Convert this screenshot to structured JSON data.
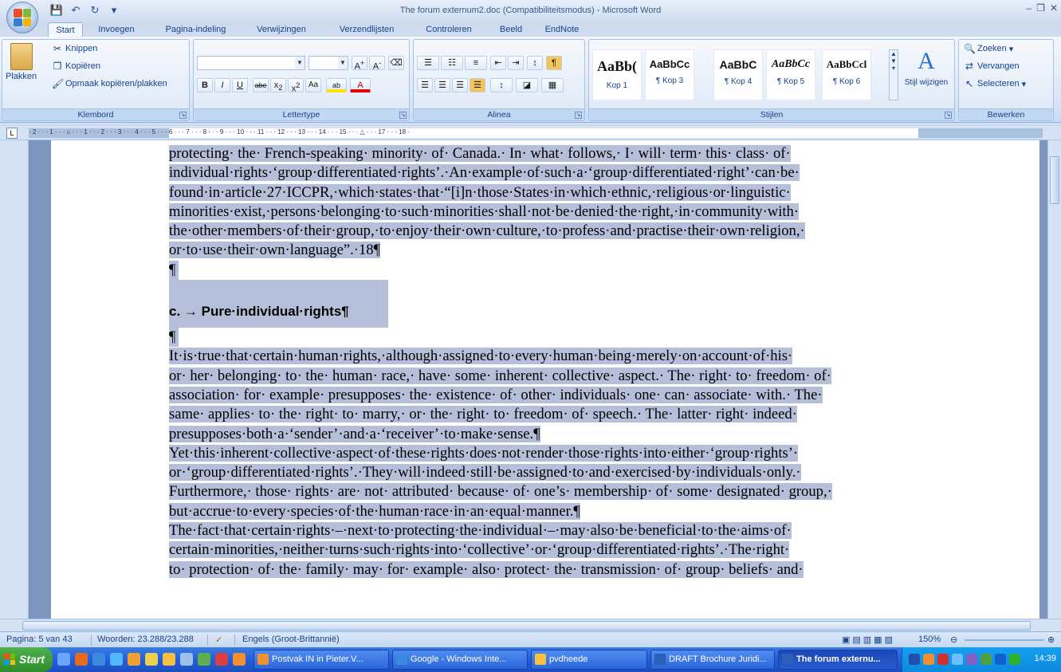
{
  "window": {
    "title": "The forum externum2.doc (Compatibiliteitsmodus) - Microsoft Word",
    "minimize": "–",
    "maximize": "❐",
    "close": "✕"
  },
  "tabs": [
    "Start",
    "Invoegen",
    "Pagina-indeling",
    "Verwijzingen",
    "Verzendlijsten",
    "Controleren",
    "Beeld",
    "EndNote"
  ],
  "ribbon": {
    "clipboard": {
      "paste": "Plakken",
      "cut": "Knippen",
      "copy": "Kopiëren",
      "format_painter": "Opmaak kopiëren/plakken",
      "label": "Klembord"
    },
    "font": {
      "label": "Lettertype",
      "font_name": "",
      "font_size": ""
    },
    "paragraph": {
      "label": "Alinea"
    },
    "styles": {
      "label": "Stijlen",
      "items": [
        {
          "sample": "AaBb(",
          "name": "Kop 1"
        },
        {
          "sample": "AaBbCc",
          "name": "¶ Kop 3"
        },
        {
          "sample": "AaBbC",
          "name": "¶ Kop 4"
        },
        {
          "sample": "AaBbCc",
          "name": "¶ Kop 5"
        },
        {
          "sample": "AaBbCcl",
          "name": "¶ Kop 6"
        }
      ],
      "change": "Stijl wijzigen"
    },
    "editing": {
      "label": "Bewerken",
      "find": "Zoeken",
      "replace": "Vervangen",
      "select": "Selecteren"
    }
  },
  "ruler": {
    "numbers": "· 2 · · · 1 · · · ⌂ · · · 1 · · · 2 · · · 3 · · · 4 · · · 5 · · · 6 · · · 7 · · · 8 · · · 9 · · · 10 · · · 11 · · · 12 · · · 13 · · · 14 · · · 15 · · · △ · · · 17 · · · 18 ·"
  },
  "document": {
    "para1": [
      "protecting· the· French-speaking· minority· of· Canada.· In· what· follows,· I· will· term· this· class· of·",
      "individual·rights·‘group·differentiated·rights’.·An·example·of·such·a·‘group·differentiated·right’·can·be·",
      "found·in·article·27·ICCPR,·which·states·that·“[i]n·those·States·in·which·ethnic,·religious·or·linguistic·",
      "minorities·exist,·persons·belonging·to·such·minorities·shall·not·be·denied·the·right,·in·community·with·",
      "the·other·members·of·their·group,·to·enjoy·their·own·culture,·to·profess·and·practise·their·own·religion,·",
      "or·to·use·their·own·language”.·18¶"
    ],
    "pilcrow": "¶",
    "heading": "c.  →  Pure·individual·rights¶",
    "para2": [
      "It·is·true·that·certain·human·rights,·although·assigned·to·every·human·being·merely·on·account·of·his·",
      "or· her· belonging· to· the· human· race,· have· some· inherent· collective· aspect.· The· right· to· freedom· of·",
      "association· for· example· presupposes· the· existence· of· other· individuals· one· can· associate· with.· The·",
      "same· applies· to· the· right· to· marry,· or· the· right· to· freedom· of· speech.· The· latter· right· indeed·",
      "presupposes·both·a·‘sender’·and·a·‘receiver’·to·make·sense.¶"
    ],
    "para3": [
      "Yet·this·inherent·collective·aspect·of·these·rights·does·not·render·those·rights·into·either·‘group·rights’·",
      "or·‘group·differentiated·rights’.·They·will·indeed·still·be·assigned·to·and·exercised·by·individuals·only.·",
      "Furthermore,· those· rights· are· not· attributed· because· of· one’s· membership· of· some· designated· group,·",
      "but·accrue·to·every·species·of·the·human·race·in·an·equal·manner.¶"
    ],
    "para4": [
      "The·fact·that·certain·rights·–·next·to·protecting·the·individual·–·may·also·be·beneficial·to·the·aims·of·",
      "certain·minorities,·neither·turns·such·rights·into·‘collective’·or·‘group·differentiated·rights’.·The·right·",
      "to· protection· of· the· family· may· for· example· also· protect· the· transmission· of· group· beliefs· and·"
    ]
  },
  "status": {
    "page": "Pagina: 5 van 43",
    "words": "Woorden: 23.288/23.288",
    "language": "Engels (Groot-Brittannië)",
    "zoom": "150%"
  },
  "taskbar": {
    "start": "Start",
    "tasks": [
      "Postvak IN in Pieter.V...",
      "Google - Windows Inte...",
      "pvdheede",
      "DRAFT Brochure Juridi...",
      "The forum externu..."
    ],
    "clock": "14:39"
  },
  "colors": {
    "selection": "#b5bfd9",
    "ribbon_text": "#15428b",
    "taskbar": "#245edb"
  }
}
